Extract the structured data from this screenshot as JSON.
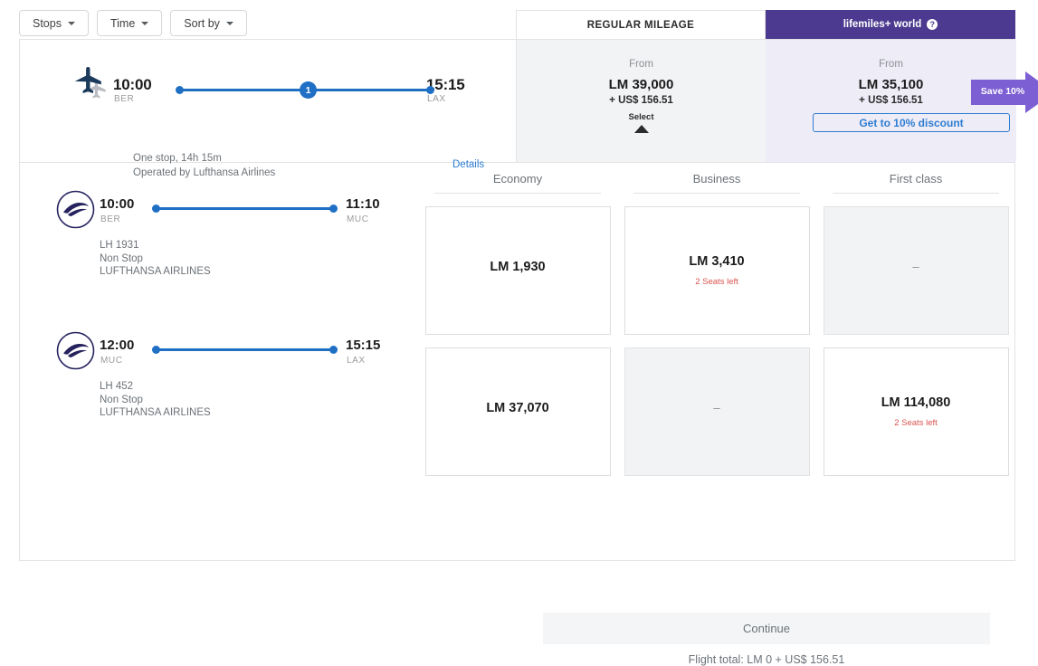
{
  "filters": [
    {
      "label": "Stops",
      "icon": "chevron-down-icon"
    },
    {
      "label": "Time",
      "icon": "chevron-down-icon"
    },
    {
      "label": "Sort by",
      "icon": "chevron-down-icon"
    }
  ],
  "tabs": [
    {
      "label": "REGULAR MILEAGE",
      "active": false
    },
    {
      "label": "lifemiles+ world",
      "active": true,
      "help": "?"
    }
  ],
  "itinerary": {
    "depart_time": "10:00",
    "depart_code": "BER",
    "arrive_time": "15:15",
    "arrive_code": "LAX",
    "stops_badge": "1",
    "summary": "One stop, 14h 15m",
    "operator": "Operated by Lufthansa Airlines",
    "details_link": "Details"
  },
  "fares": {
    "regular": {
      "from_label": "From",
      "miles": "LM 39,000",
      "cash": "+ US$ 156.51",
      "select_label": "Select"
    },
    "plus": {
      "from_label": "From",
      "miles": "LM 35,100",
      "cash": "+ US$ 156.51",
      "discount_button": "Get to 10% discount"
    },
    "save_badge": "Save 10%"
  },
  "segments": [
    {
      "depart_time": "10:00",
      "depart_code": "BER",
      "arrive_time": "11:10",
      "arrive_code": "MUC",
      "flight_number": "LH 1931",
      "stops": "Non Stop",
      "airline": "LUFTHANSA AIRLINES"
    },
    {
      "depart_time": "12:00",
      "depart_code": "MUC",
      "arrive_time": "15:15",
      "arrive_code": "LAX",
      "flight_number": "LH 452",
      "stops": "Non Stop",
      "airline": "LUFTHANSA AIRLINES"
    }
  ],
  "cabin_classes": [
    "Economy",
    "Business",
    "First class"
  ],
  "fare_grid": [
    [
      {
        "price": "LM 1,930",
        "seats": "",
        "disabled": false
      },
      {
        "price": "LM 3,410",
        "seats": "2 Seats left",
        "disabled": false
      },
      {
        "price": "–",
        "seats": "",
        "disabled": true
      }
    ],
    [
      {
        "price": "LM 37,070",
        "seats": "",
        "disabled": false
      },
      {
        "price": "–",
        "seats": "",
        "disabled": true
      },
      {
        "price": "LM 114,080",
        "seats": "2 Seats left",
        "disabled": false
      }
    ]
  ],
  "footer": {
    "continue_label": "Continue",
    "flight_total": "Flight total: LM 0 + US$ 156.51"
  },
  "colors": {
    "brand_purple": "#4b3a8f",
    "save_purple": "#7c5fd3",
    "link_blue": "#2d7dd2",
    "route_blue": "#1f6fc4",
    "alert_red": "#d9534f",
    "panel_gray": "#f2f3f5",
    "panel_lavender": "#eeecf7"
  }
}
